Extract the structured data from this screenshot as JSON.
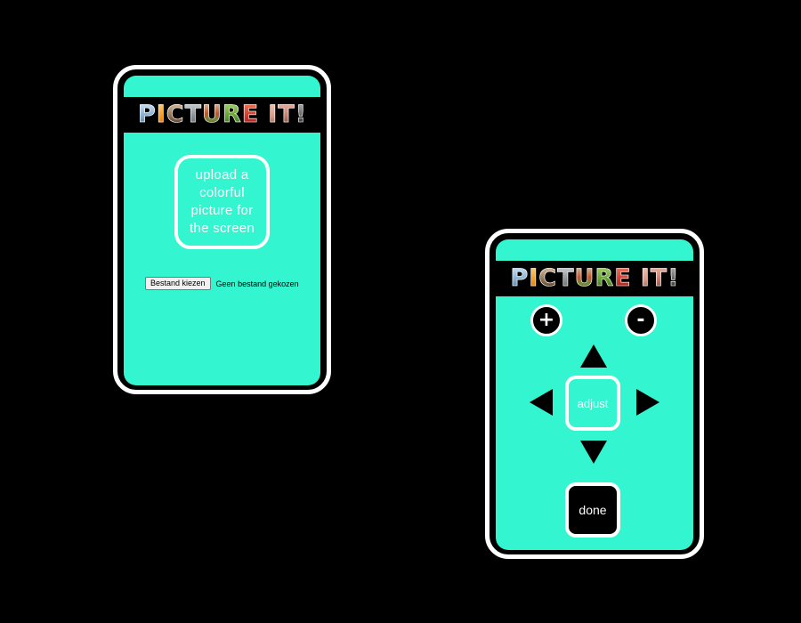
{
  "logo": {
    "word1": [
      "P",
      "I",
      "C",
      "T",
      "U",
      "R",
      "E"
    ],
    "word2": [
      "I",
      "T",
      "!"
    ],
    "tile_fills": [
      "linear-gradient(180deg,#cfe4f5 0%,#7fa7c9 60%,#3c6f9c 100%)",
      "linear-gradient(180deg,#ffd27a 0%,#f79a1e 55%,#e86a10 100%)",
      "linear-gradient(180deg,#d9c2a5 0%,#8a6a4c 60%,#3e3128 100%)",
      "linear-gradient(180deg,#cfd3d6 0%,#8e969c 50%,#5a6066 100%)",
      "linear-gradient(180deg,#d9c2a0 0%,#c2562b 45%,#6e8c3a 70%,#8b5a2b 100%)",
      "linear-gradient(180deg,#a6d46a 0%,#5f9c2f 60%,#2f5f16 100%)",
      "linear-gradient(180deg,#f07a5a 0%,#c8362a 60%,#8a1e18 100%)",
      "linear-gradient(180deg,#f2c5b2 0%,#d99a86 55%,#9a5a48 100%)",
      "linear-gradient(180deg,#e8b8a8 0%,#c37a6a 55%,#7a3e34 100%)",
      "linear-gradient(180deg,#b4b4b4 0%,#666 50%,#222 100%)"
    ]
  },
  "upload_screen": {
    "prompt": "upload a colorful picture for the screen",
    "file_button_label": "Bestand kiezen",
    "file_status": "Geen bestand gekozen"
  },
  "control_screen": {
    "zoom_in_label": "+",
    "zoom_out_label": "-",
    "adjust_label": "adjust",
    "done_label": "done"
  },
  "colors": {
    "background": "#000000",
    "screen": "#33f5d0",
    "frame": "#ffffff"
  }
}
